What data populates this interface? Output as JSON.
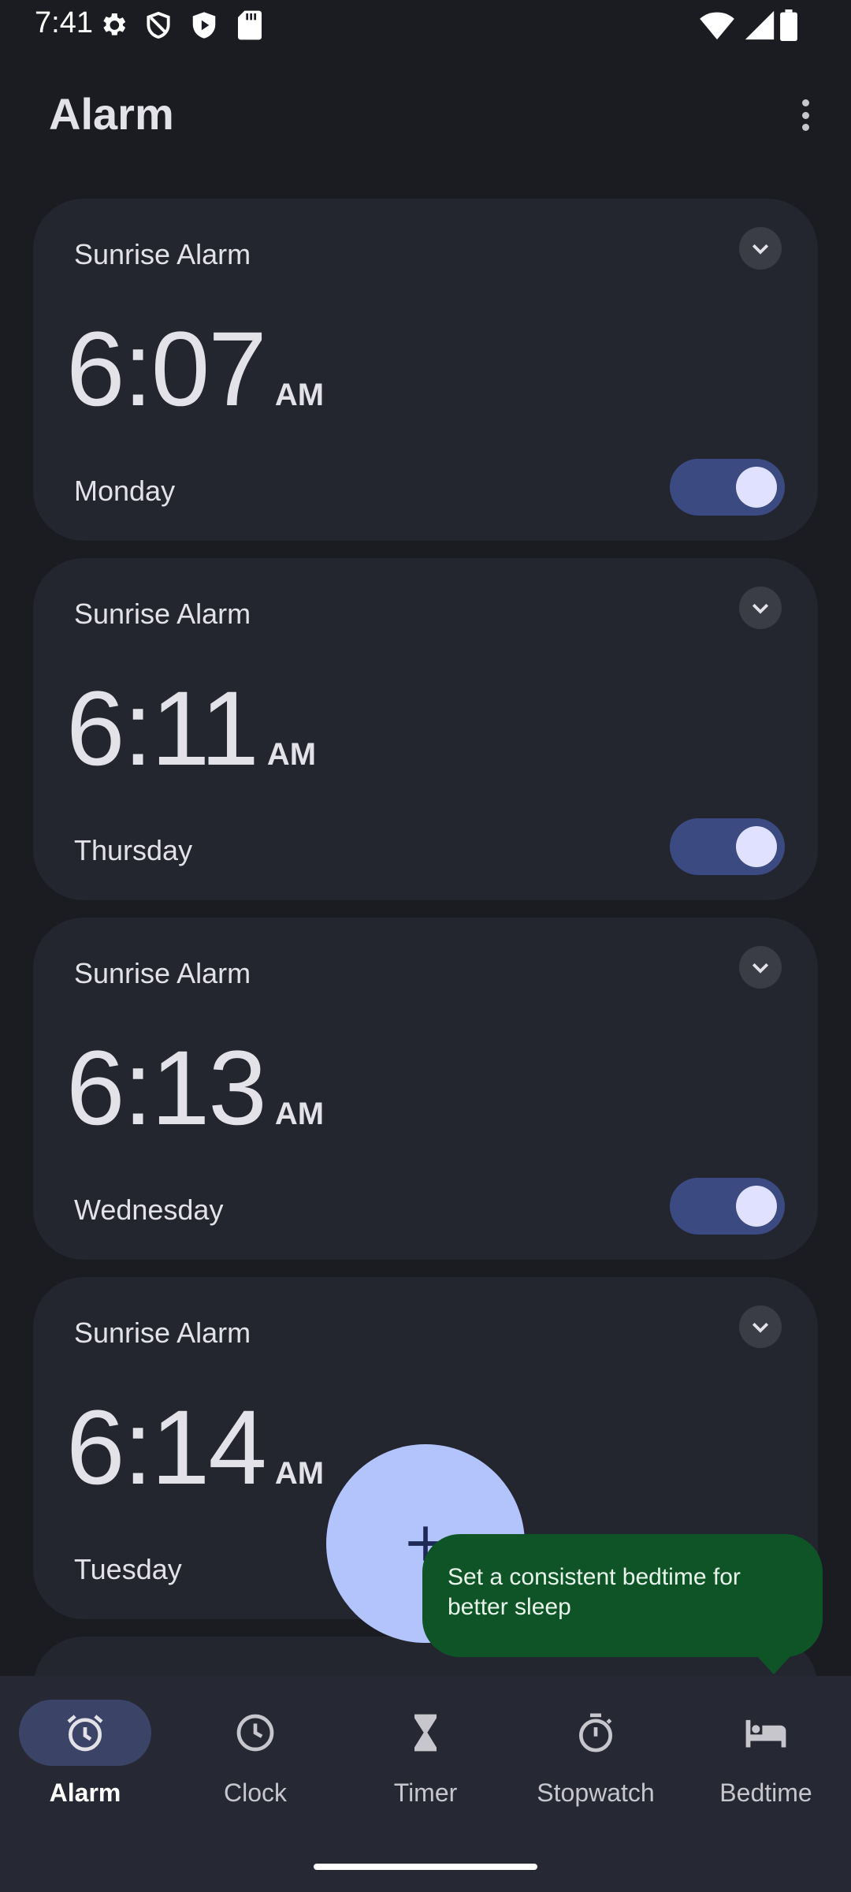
{
  "status_bar": {
    "time": "7:41",
    "left_icons": [
      "settings-icon",
      "shield-icon",
      "play-protect-icon",
      "sd-card-icon"
    ],
    "right_icons": [
      "wifi-icon",
      "signal-icon",
      "battery-icon"
    ]
  },
  "app_bar": {
    "title": "Alarm",
    "overflow_icon": "more-vert-icon"
  },
  "alarms": [
    {
      "label": "Sunrise Alarm",
      "time": "6:07",
      "ampm": "AM",
      "days": "Monday",
      "enabled": true
    },
    {
      "label": "Sunrise Alarm",
      "time": "6:11",
      "ampm": "AM",
      "days": "Thursday",
      "enabled": true
    },
    {
      "label": "Sunrise Alarm",
      "time": "6:13",
      "ampm": "AM",
      "days": "Wednesday",
      "enabled": true
    },
    {
      "label": "Sunrise Alarm",
      "time": "6:14",
      "ampm": "AM",
      "days": "Tuesday",
      "enabled": true
    }
  ],
  "fab": {
    "icon": "plus-icon"
  },
  "tooltip": {
    "text": "Set a consistent bedtime for better sleep"
  },
  "bottom_nav": {
    "items": [
      {
        "label": "Alarm",
        "icon": "alarm-icon",
        "active": true
      },
      {
        "label": "Clock",
        "icon": "clock-icon",
        "active": false
      },
      {
        "label": "Timer",
        "icon": "hourglass-icon",
        "active": false
      },
      {
        "label": "Stopwatch",
        "icon": "stopwatch-icon",
        "active": false
      },
      {
        "label": "Bedtime",
        "icon": "bed-icon",
        "active": false
      }
    ]
  },
  "colors": {
    "background": "#1b1c21",
    "card": "#23252f",
    "toggle_track": "#3c4a82",
    "toggle_knob": "#dfe1ff",
    "fab": "#b3c3fb",
    "tooltip": "#0f5427",
    "nav_active_pill": "#3b4467"
  }
}
